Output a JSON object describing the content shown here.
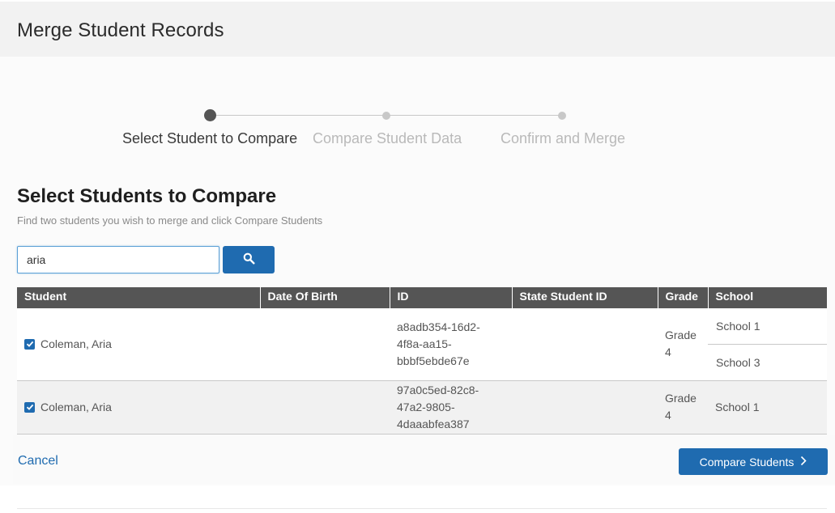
{
  "header": {
    "title": "Merge Student Records"
  },
  "stepper": {
    "steps": [
      {
        "label": "Select Student to Compare",
        "state": "active"
      },
      {
        "label": "Compare Student Data",
        "state": "inactive"
      },
      {
        "label": "Confirm and Merge",
        "state": "inactive"
      }
    ]
  },
  "section": {
    "title": "Select Students to Compare",
    "subtitle": "Find two students you wish to merge and click Compare Students"
  },
  "search": {
    "value": "aria",
    "icon": "search-icon"
  },
  "table": {
    "columns": [
      "Student",
      "Date Of Birth",
      "ID",
      "State Student ID",
      "Grade",
      "School"
    ],
    "rows": [
      {
        "checked": true,
        "student": "Coleman, Aria",
        "dob": "",
        "id_lines": [
          "a8adb354-16d2-",
          "4f8a-aa15-",
          "bbbf5ebde67e"
        ],
        "state_id": "",
        "grade_lines": [
          "Grade",
          "4"
        ],
        "schools": [
          "School 1",
          "School 3"
        ]
      },
      {
        "checked": true,
        "student": "Coleman, Aria",
        "dob": "",
        "id_lines": [
          "97a0c5ed-82c8-",
          "47a2-9805-",
          "4daaabfea387"
        ],
        "state_id": "",
        "grade_lines": [
          "Grade",
          "4"
        ],
        "schools": [
          "School 1"
        ]
      }
    ]
  },
  "footer": {
    "cancel_label": "Cancel",
    "compare_label": "Compare Students"
  },
  "colors": {
    "primary": "#1f6bb0",
    "header_bg": "#f2f2f2",
    "table_header": "#555555"
  }
}
